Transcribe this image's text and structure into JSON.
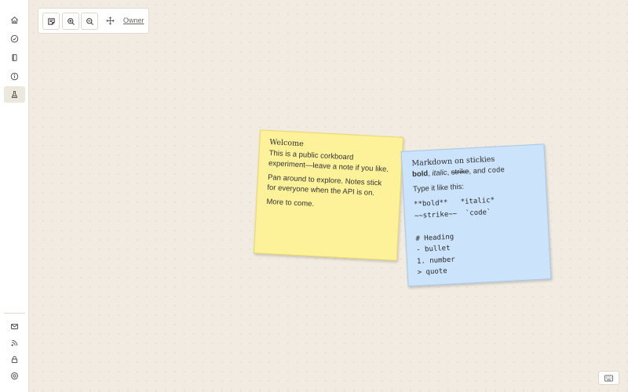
{
  "sidebar": {
    "top_items": [
      {
        "icon": "home-icon"
      },
      {
        "icon": "check-circle-icon"
      },
      {
        "icon": "book-icon"
      },
      {
        "icon": "info-circle-icon"
      },
      {
        "icon": "flask-icon",
        "active": true
      }
    ],
    "bottom_items": [
      {
        "icon": "mail-icon"
      },
      {
        "icon": "rss-icon"
      },
      {
        "icon": "lock-icon"
      },
      {
        "icon": "settings-icon"
      }
    ]
  },
  "toolbar": {
    "buttons": [
      {
        "icon": "sticky-note-icon"
      },
      {
        "icon": "zoom-in-icon"
      },
      {
        "icon": "zoom-out-icon"
      },
      {
        "icon": "move-icon"
      }
    ],
    "owner_label": "Owner"
  },
  "stickies": [
    {
      "color": "#fdf19a",
      "title": "Welcome",
      "paragraphs": [
        "This is a public corkboard experiment—leave a note if you like.",
        "Pan around to explore. Notes stick for everyone when the API is on.",
        "More to come."
      ]
    },
    {
      "color": "#cbe3fb",
      "title": "Markdown on stickies",
      "demo": {
        "bold": "bold",
        "sep1": ", ",
        "italic": "italic",
        "sep2": ", ",
        "strike": "strike",
        "sep3": ", and ",
        "code": "code"
      },
      "instruction": "Type it like this:",
      "code_lines": [
        "**bold**   *italic*",
        "~~strike~~  `code`",
        "",
        "# Heading",
        "- bullet",
        "1. number",
        "> quote"
      ]
    }
  ],
  "keyboard_button": {
    "icon": "keyboard-icon"
  }
}
